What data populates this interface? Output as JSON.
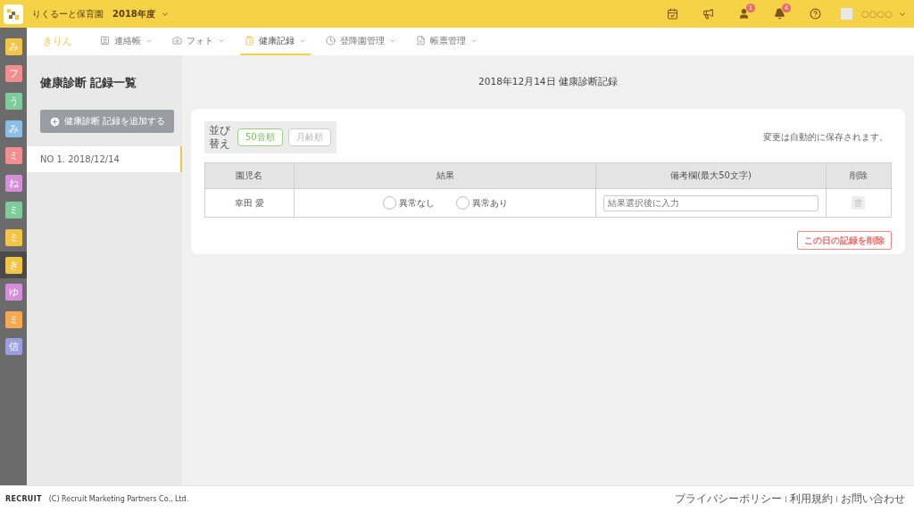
{
  "header": {
    "school": "りくるーと保育園",
    "year": "2018年度",
    "badges": [
      {
        "kind": "calendar"
      },
      {
        "kind": "megaphone"
      },
      {
        "kind": "person",
        "count": "1"
      },
      {
        "kind": "bell",
        "count": "4"
      },
      {
        "kind": "help"
      }
    ],
    "user": "○○○○"
  },
  "rail": [
    {
      "label": "み",
      "color": "#f0c548",
      "selected": false
    },
    {
      "label": "フ",
      "color": "#ef8f8f",
      "selected": false
    },
    {
      "label": "う",
      "color": "#7fcb9c",
      "selected": false
    },
    {
      "label": "み",
      "color": "#8bbfe8",
      "selected": false
    },
    {
      "label": "ミ",
      "color": "#ef8f8f",
      "selected": false
    },
    {
      "label": "ね",
      "color": "#d48fd8",
      "selected": false
    },
    {
      "label": "ミ",
      "color": "#7fcb9c",
      "selected": false
    },
    {
      "label": "ミ",
      "color": "#f0c548",
      "selected": false
    },
    {
      "label": "き",
      "color": "#f0c548",
      "selected": true
    },
    {
      "label": "ゆ",
      "color": "#d48fd8",
      "selected": false
    },
    {
      "label": "ミ",
      "color": "#f5a953",
      "selected": false
    },
    {
      "label": "信",
      "color": "#9b9ee0",
      "selected": false
    }
  ],
  "nav": {
    "class_name": "きりん",
    "tabs": [
      {
        "label": "連絡帳",
        "kind": "contact",
        "selected": false
      },
      {
        "label": "フォト",
        "kind": "camera",
        "selected": false
      },
      {
        "label": "健康記録",
        "kind": "health",
        "selected": true
      },
      {
        "label": "登降園管理",
        "kind": "clock",
        "selected": false
      },
      {
        "label": "帳票管理",
        "kind": "form",
        "selected": false
      }
    ]
  },
  "sidebar": {
    "title": "健康診断 記録一覧",
    "add_button": "健康診断 記録を追加する",
    "items": [
      {
        "label": "NO 1. 2018/12/14",
        "selected": true
      }
    ]
  },
  "main": {
    "title": "2018年12月14日 健康診断記録",
    "sort_label": "並び替え",
    "sort_options": [
      {
        "label": "50音順",
        "selected": true
      },
      {
        "label": "月齢順",
        "selected": false
      }
    ],
    "autosave_note": "変更は自動的に保存されます。",
    "table": {
      "columns": [
        "園児名",
        "結果",
        "備考欄(最大50文字)",
        "削除"
      ],
      "rows": [
        {
          "name": "幸田 愛",
          "options": [
            {
              "label": "異常なし",
              "selected": false
            },
            {
              "label": "異常あり",
              "selected": false
            }
          ],
          "note_placeholder": "結果選択後に入力"
        }
      ]
    },
    "delete_day_button": "この日の記録を削除"
  },
  "footer": {
    "logo": "RECRUIT",
    "copyright": "(C) Recruit Marketing Partners Co., Ltd.",
    "links": [
      "プライバシーポリシー",
      "利用規約",
      "お問い合わせ"
    ]
  }
}
